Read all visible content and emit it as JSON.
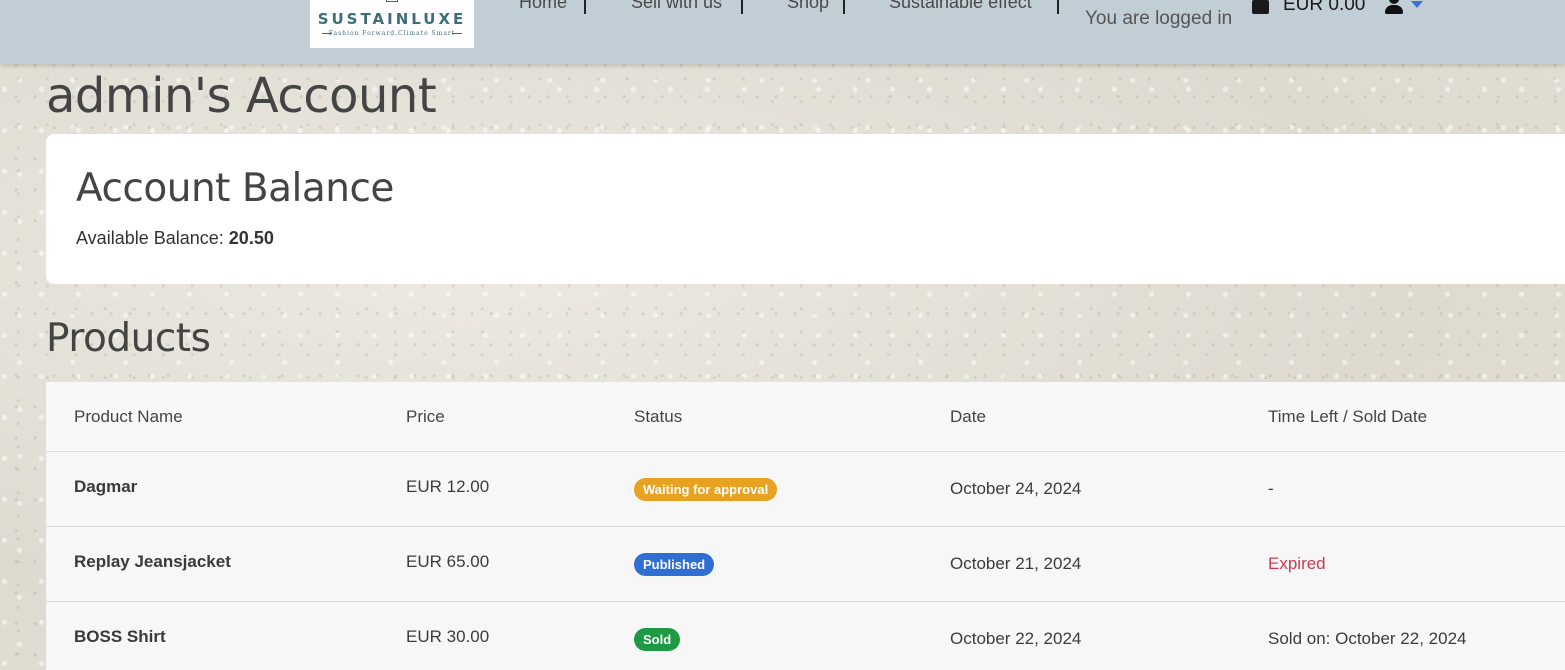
{
  "brand": {
    "name": "SUSTAINLUXE",
    "tagline": "Fashion Forward.Climate Smart"
  },
  "nav": {
    "links": [
      "Home",
      "Sell with us",
      "Shop",
      "Sustainable effect"
    ],
    "status": "You are logged in",
    "cart_total": "EUR 0.00",
    "icons": [
      "shopping-bag-icon",
      "user-icon",
      "caret-down-icon"
    ],
    "caret_color": "#3b6fd0"
  },
  "page": {
    "title": "admin's Account"
  },
  "balance": {
    "title": "Account Balance",
    "label": "Available Balance:",
    "amount": "20.50"
  },
  "products": {
    "title": "Products",
    "columns": [
      "Product Name",
      "Price",
      "Status",
      "Date",
      "Time Left / Sold Date"
    ],
    "rows": [
      {
        "name": "Dagmar",
        "price": "EUR 12.00",
        "status": "Waiting for approval",
        "date": "October 24, 2024",
        "time_left": "-"
      },
      {
        "name": "Replay Jeansjacket",
        "price": "EUR 65.00",
        "status": "Published",
        "date": "October 21, 2024",
        "time_left": "Expired"
      },
      {
        "name": "BOSS Shirt",
        "price": "EUR 30.00",
        "status": "Sold",
        "date": "October 22, 2024",
        "time_left": "Sold on: October 22, 2024"
      }
    ]
  },
  "colors": {
    "navbar": "#c2ced6",
    "waiting": "#e8a221",
    "published": "#2f6fd1",
    "sold": "#1e9a45",
    "expired": "#d0394e"
  }
}
